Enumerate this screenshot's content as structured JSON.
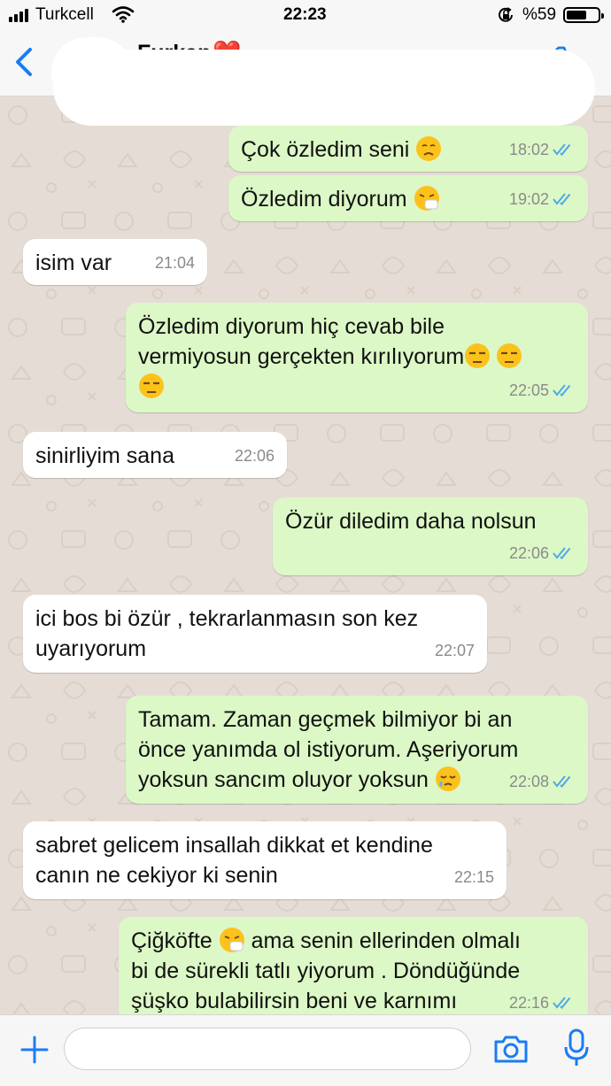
{
  "status_bar": {
    "carrier": "Turkcell",
    "time": "22:23",
    "battery_text": "%59"
  },
  "header": {
    "contact_name": "Furkan",
    "contact_emoji": "❤️"
  },
  "messages": [
    {
      "direction": "outgoing",
      "text": "Çok özledim seni",
      "emoji": "disappointed",
      "time": "18:02",
      "read": true
    },
    {
      "direction": "outgoing",
      "text": "Özledim diyorum",
      "emoji": "sneezing",
      "time": "19:02",
      "read": true
    },
    {
      "direction": "incoming",
      "text": "isim var",
      "time": "21:04"
    },
    {
      "direction": "outgoing",
      "lines": [
        "Özledim diyorum hiç cevab bile",
        "vermiyosun gerçekten kırılıyorum"
      ],
      "emoji": "unamused x3",
      "time": "22:05",
      "read": true
    },
    {
      "direction": "incoming",
      "text": "sinirliyim sana",
      "time": "22:06"
    },
    {
      "direction": "outgoing",
      "text": "Özür diledim daha nolsun",
      "time": "22:06",
      "read": true
    },
    {
      "direction": "incoming",
      "lines": [
        "ici bos bi özür , tekrarlanmasın son kez",
        "uyarıyorum"
      ],
      "time": "22:07"
    },
    {
      "direction": "outgoing",
      "lines": [
        "Tamam. Zaman geçmek bilmiyor bi an",
        "önce yanımda ol istiyorum. Aşeriyorum",
        "yoksun sancım oluyor yoksun"
      ],
      "emoji": "sleepy",
      "time": "22:08",
      "read": true
    },
    {
      "direction": "incoming",
      "lines": [
        "sabret gelicem insallah dikkat et kendine",
        "canın ne cekiyor ki senin"
      ],
      "time": "22:15"
    },
    {
      "direction": "outgoing",
      "lines": [
        "Çiğköfte",
        "ama senin ellerinden olmalı",
        "bi de sürekli tatlı yiyorum . Döndüğünde",
        "şüşko bulabilirsin beni ve karnımı"
      ],
      "emoji": "sneezing",
      "time": "22:16",
      "read": true
    }
  ],
  "composer": {
    "value": "",
    "placeholder": ""
  },
  "colors": {
    "accent": "#1a7cf5",
    "outgoing_bubble": "#dcf8c6",
    "incoming_bubble": "#ffffff",
    "read_ticks": "#4fa9e8",
    "chat_background": "#e5ddd5"
  },
  "icons": [
    "signal-bars-icon",
    "wifi-icon",
    "rotation-lock-icon",
    "battery-icon",
    "back-chevron-icon",
    "video-call-icon",
    "phone-icon",
    "plus-icon",
    "camera-icon",
    "microphone-icon"
  ]
}
